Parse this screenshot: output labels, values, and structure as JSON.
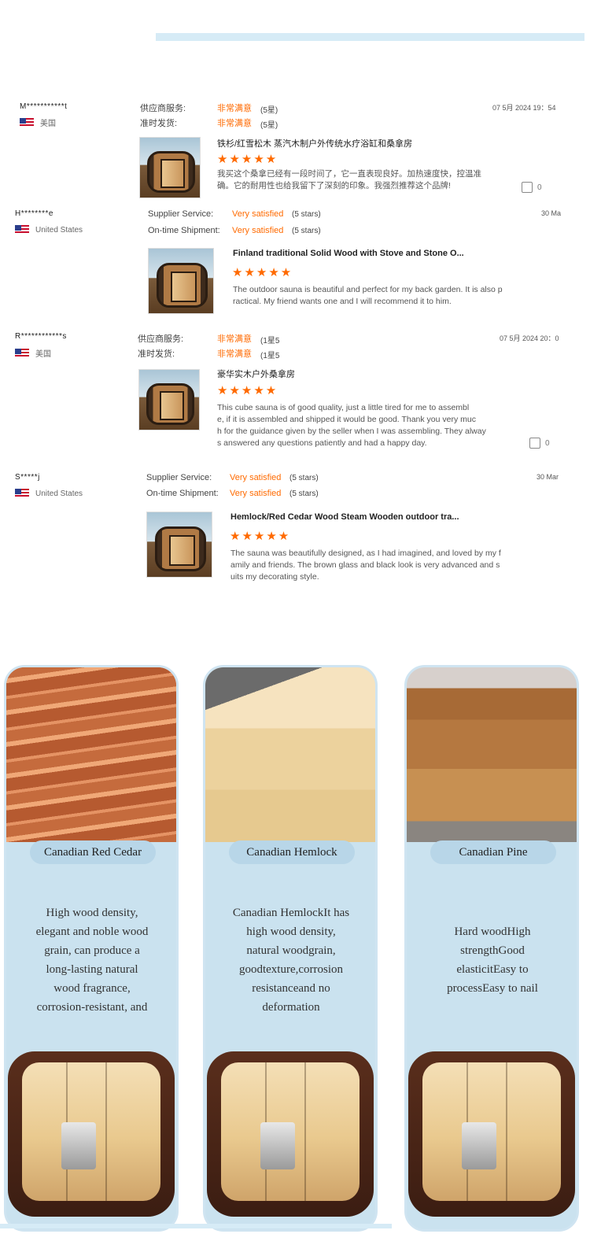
{
  "reviews": [
    {
      "name": "M***********t",
      "country": "美国",
      "service_label": "供应商服务:",
      "service_value": "非常满意",
      "service_stars": "(5星)",
      "shipment_label": "准时发货:",
      "shipment_value": "非常满意",
      "shipment_stars": "(5星)",
      "date": "07 5月 2024 19：54",
      "title": "铁杉/红雪松木 蒸汽木制户外传统水疗浴缸和桑拿房",
      "rating": "★★★★★",
      "text_lines": [
        "我买这个桑拿已经有一段时间了，它一直表现良好。加热速度快，控温准",
        "确。它的耐用性也给我留下了深刻的印象。我强烈推荐这个品牌!"
      ],
      "likes": "0"
    },
    {
      "name": "H********e",
      "country": "United States",
      "service_label": "Supplier Service:",
      "service_value": "Very satisfied",
      "service_stars": "(5 stars)",
      "shipment_label": "On-time Shipment:",
      "shipment_value": "Very satisfied",
      "shipment_stars": "(5 stars)",
      "date": "30 Ma",
      "title": "Finland traditional Solid Wood with Stove and Stone O...",
      "rating": "★★★★★",
      "text_lines": [
        "The outdoor sauna is beautiful and perfect for my back garden. It is also p",
        "ractical. My friend wants one and I will recommend it to him."
      ],
      "likes": ""
    },
    {
      "name": "R************s",
      "country": "美国",
      "service_label": "供应商服务:",
      "service_value": "非常满意",
      "service_stars": "(1星5",
      "shipment_label": "准时发货:",
      "shipment_value": "非常满意",
      "shipment_stars": "(1星5",
      "date": "07 5月 2024 20：0",
      "title": "豪华实木户外桑拿房",
      "rating": "★★★★★",
      "text_lines": [
        "This cube sauna is of good quality,  just a little tired for me to assembl",
        "e,  if it is assembled and shipped it would be good.  Thank you very muc",
        "h for the guidance given by the seller when I was assembling.  They alway",
        "s answered any questions patiently and had a happy day."
      ],
      "likes": "0"
    },
    {
      "name": "S*****j",
      "country": "United States",
      "service_label": "Supplier Service:",
      "service_value": "Very satisfied",
      "service_stars": "(5 stars)",
      "shipment_label": "On-time Shipment:",
      "shipment_value": "Very satisfied",
      "shipment_stars": "(5 stars)",
      "date": "30 Mar",
      "title": "Hemlock/Red Cedar Wood Steam Wooden outdoor tra...",
      "rating": "★★★★★",
      "text_lines": [
        "The sauna was beautifully designed, as I had imagined, and loved by my f",
        "amily and friends. The brown glass and black look is very advanced and s",
        "uits my decorating style."
      ],
      "likes": ""
    }
  ],
  "wood_cards": [
    {
      "tag": "Canadian Red Cedar",
      "desc_lines": [
        "High wood density,",
        "elegant and noble wood",
        "grain, can produce a",
        "long-lasting natural",
        "wood fragrance,",
        "corrosion-resistant, and"
      ]
    },
    {
      "tag": "Canadian Hemlock",
      "desc_lines": [
        "Canadian HemlockIt has",
        "high wood density,",
        "natural woodgrain,",
        "goodtexture,corrosion",
        "resistanceand no",
        "deformation"
      ]
    },
    {
      "tag": "Canadian Pine",
      "desc_lines": [
        "Hard woodHigh",
        "strengthGood",
        "elasticitEasy to",
        "processEasy to nail"
      ]
    }
  ]
}
